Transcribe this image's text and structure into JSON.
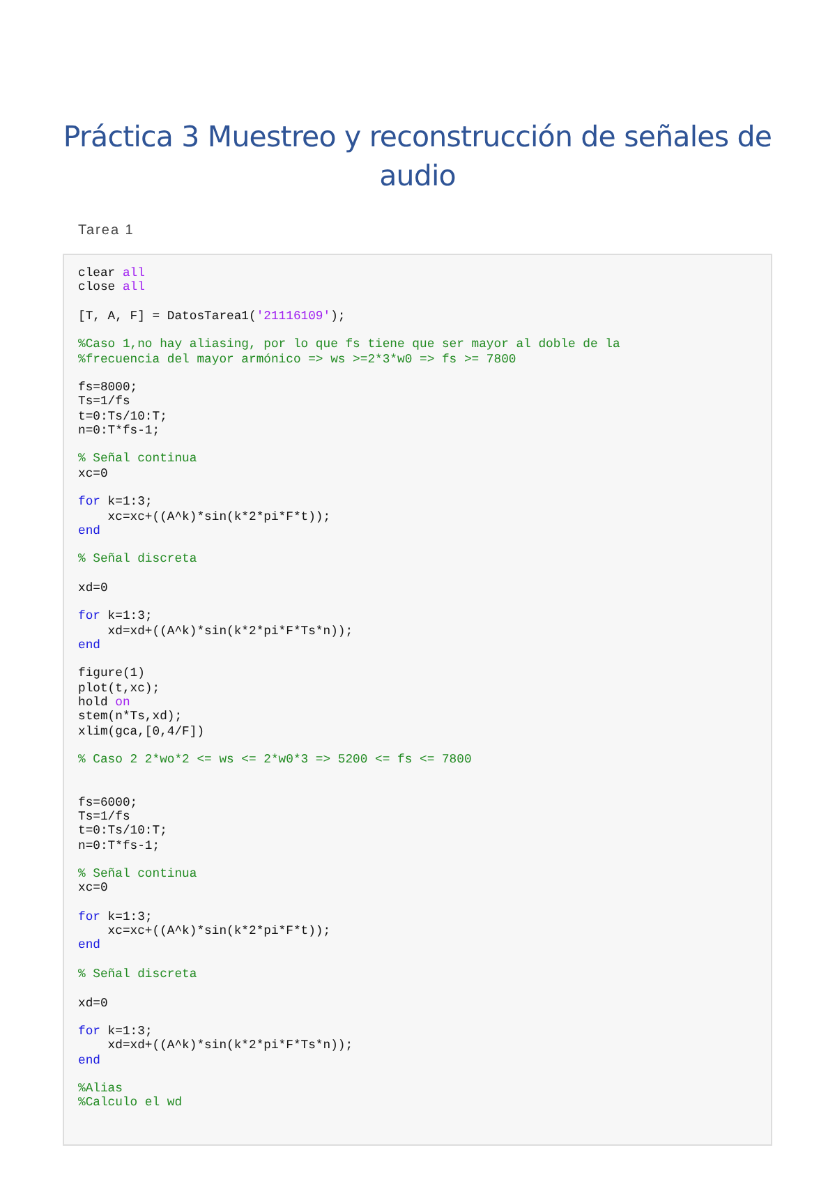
{
  "title": "Práctica 3 Muestreo y reconstrucción de señales de audio",
  "section": "Tarea 1",
  "code_lines": [
    {
      "kind": "code",
      "segments": [
        {
          "kind": "plain",
          "text": "clear "
        },
        {
          "kind": "string",
          "text": "all"
        }
      ]
    },
    {
      "kind": "code",
      "segments": [
        {
          "kind": "plain",
          "text": "close "
        },
        {
          "kind": "string",
          "text": "all"
        }
      ]
    },
    {
      "kind": "blank"
    },
    {
      "kind": "code",
      "segments": [
        {
          "kind": "plain",
          "text": "[T, A, F] = DatosTarea1("
        },
        {
          "kind": "string",
          "text": "'21116109'"
        },
        {
          "kind": "plain",
          "text": ");"
        }
      ]
    },
    {
      "kind": "blank"
    },
    {
      "kind": "code",
      "segments": [
        {
          "kind": "comment",
          "text": "%Caso 1,no hay aliasing, por lo que fs tiene que ser mayor al doble de la"
        }
      ]
    },
    {
      "kind": "code",
      "segments": [
        {
          "kind": "comment",
          "text": "%frecuencia del mayor armónico => ws >=2*3*w0 => fs >= 7800"
        }
      ]
    },
    {
      "kind": "blank"
    },
    {
      "kind": "code",
      "segments": [
        {
          "kind": "plain",
          "text": "fs=8000;"
        }
      ]
    },
    {
      "kind": "code",
      "segments": [
        {
          "kind": "plain",
          "text": "Ts=1/fs"
        }
      ]
    },
    {
      "kind": "code",
      "segments": [
        {
          "kind": "plain",
          "text": "t=0:Ts/10:T;"
        }
      ]
    },
    {
      "kind": "code",
      "segments": [
        {
          "kind": "plain",
          "text": "n=0:T*fs-1;"
        }
      ]
    },
    {
      "kind": "blank"
    },
    {
      "kind": "code",
      "segments": [
        {
          "kind": "comment",
          "text": "% Señal continua"
        }
      ]
    },
    {
      "kind": "code",
      "segments": [
        {
          "kind": "plain",
          "text": "xc=0"
        }
      ]
    },
    {
      "kind": "blank"
    },
    {
      "kind": "code",
      "segments": [
        {
          "kind": "keyword",
          "text": "for"
        },
        {
          "kind": "plain",
          "text": " k=1:3;"
        }
      ]
    },
    {
      "kind": "code",
      "segments": [
        {
          "kind": "plain",
          "text": "    xc=xc+((A^k)*sin(k*2*pi*F*t));"
        }
      ]
    },
    {
      "kind": "code",
      "segments": [
        {
          "kind": "keyword",
          "text": "end"
        }
      ]
    },
    {
      "kind": "blank"
    },
    {
      "kind": "code",
      "segments": [
        {
          "kind": "comment",
          "text": "% Señal discreta"
        }
      ]
    },
    {
      "kind": "blank"
    },
    {
      "kind": "code",
      "segments": [
        {
          "kind": "plain",
          "text": "xd=0"
        }
      ]
    },
    {
      "kind": "blank"
    },
    {
      "kind": "code",
      "segments": [
        {
          "kind": "keyword",
          "text": "for"
        },
        {
          "kind": "plain",
          "text": " k=1:3;"
        }
      ]
    },
    {
      "kind": "code",
      "segments": [
        {
          "kind": "plain",
          "text": "    xd=xd+((A^k)*sin(k*2*pi*F*Ts*n));"
        }
      ]
    },
    {
      "kind": "code",
      "segments": [
        {
          "kind": "keyword",
          "text": "end"
        }
      ]
    },
    {
      "kind": "blank"
    },
    {
      "kind": "code",
      "segments": [
        {
          "kind": "plain",
          "text": "figure(1)"
        }
      ]
    },
    {
      "kind": "code",
      "segments": [
        {
          "kind": "plain",
          "text": "plot(t,xc);"
        }
      ]
    },
    {
      "kind": "code",
      "segments": [
        {
          "kind": "plain",
          "text": "hold "
        },
        {
          "kind": "string",
          "text": "on"
        }
      ]
    },
    {
      "kind": "code",
      "segments": [
        {
          "kind": "plain",
          "text": "stem(n*Ts,xd);"
        }
      ]
    },
    {
      "kind": "code",
      "segments": [
        {
          "kind": "plain",
          "text": "xlim(gca,[0,4/F])"
        }
      ]
    },
    {
      "kind": "blank"
    },
    {
      "kind": "code",
      "segments": [
        {
          "kind": "comment",
          "text": "% Caso 2 2*wo*2 <= ws <= 2*w0*3 => 5200 <= fs <= 7800"
        }
      ]
    },
    {
      "kind": "blank"
    },
    {
      "kind": "blank"
    },
    {
      "kind": "code",
      "segments": [
        {
          "kind": "plain",
          "text": "fs=6000;"
        }
      ]
    },
    {
      "kind": "code",
      "segments": [
        {
          "kind": "plain",
          "text": "Ts=1/fs"
        }
      ]
    },
    {
      "kind": "code",
      "segments": [
        {
          "kind": "plain",
          "text": "t=0:Ts/10:T;"
        }
      ]
    },
    {
      "kind": "code",
      "segments": [
        {
          "kind": "plain",
          "text": "n=0:T*fs-1;"
        }
      ]
    },
    {
      "kind": "blank"
    },
    {
      "kind": "code",
      "segments": [
        {
          "kind": "comment",
          "text": "% Señal continua"
        }
      ]
    },
    {
      "kind": "code",
      "segments": [
        {
          "kind": "plain",
          "text": "xc=0"
        }
      ]
    },
    {
      "kind": "blank"
    },
    {
      "kind": "code",
      "segments": [
        {
          "kind": "keyword",
          "text": "for"
        },
        {
          "kind": "plain",
          "text": " k=1:3;"
        }
      ]
    },
    {
      "kind": "code",
      "segments": [
        {
          "kind": "plain",
          "text": "    xc=xc+((A^k)*sin(k*2*pi*F*t));"
        }
      ]
    },
    {
      "kind": "code",
      "segments": [
        {
          "kind": "keyword",
          "text": "end"
        }
      ]
    },
    {
      "kind": "blank"
    },
    {
      "kind": "code",
      "segments": [
        {
          "kind": "comment",
          "text": "% Señal discreta"
        }
      ]
    },
    {
      "kind": "blank"
    },
    {
      "kind": "code",
      "segments": [
        {
          "kind": "plain",
          "text": "xd=0"
        }
      ]
    },
    {
      "kind": "blank"
    },
    {
      "kind": "code",
      "segments": [
        {
          "kind": "keyword",
          "text": "for"
        },
        {
          "kind": "plain",
          "text": " k=1:3;"
        }
      ]
    },
    {
      "kind": "code",
      "segments": [
        {
          "kind": "plain",
          "text": "    xd=xd+((A^k)*sin(k*2*pi*F*Ts*n));"
        }
      ]
    },
    {
      "kind": "code",
      "segments": [
        {
          "kind": "keyword",
          "text": "end"
        }
      ]
    },
    {
      "kind": "blank"
    },
    {
      "kind": "code",
      "segments": [
        {
          "kind": "comment",
          "text": "%Alias"
        }
      ]
    },
    {
      "kind": "code",
      "segments": [
        {
          "kind": "comment",
          "text": "%Calculo el wd"
        }
      ]
    }
  ]
}
